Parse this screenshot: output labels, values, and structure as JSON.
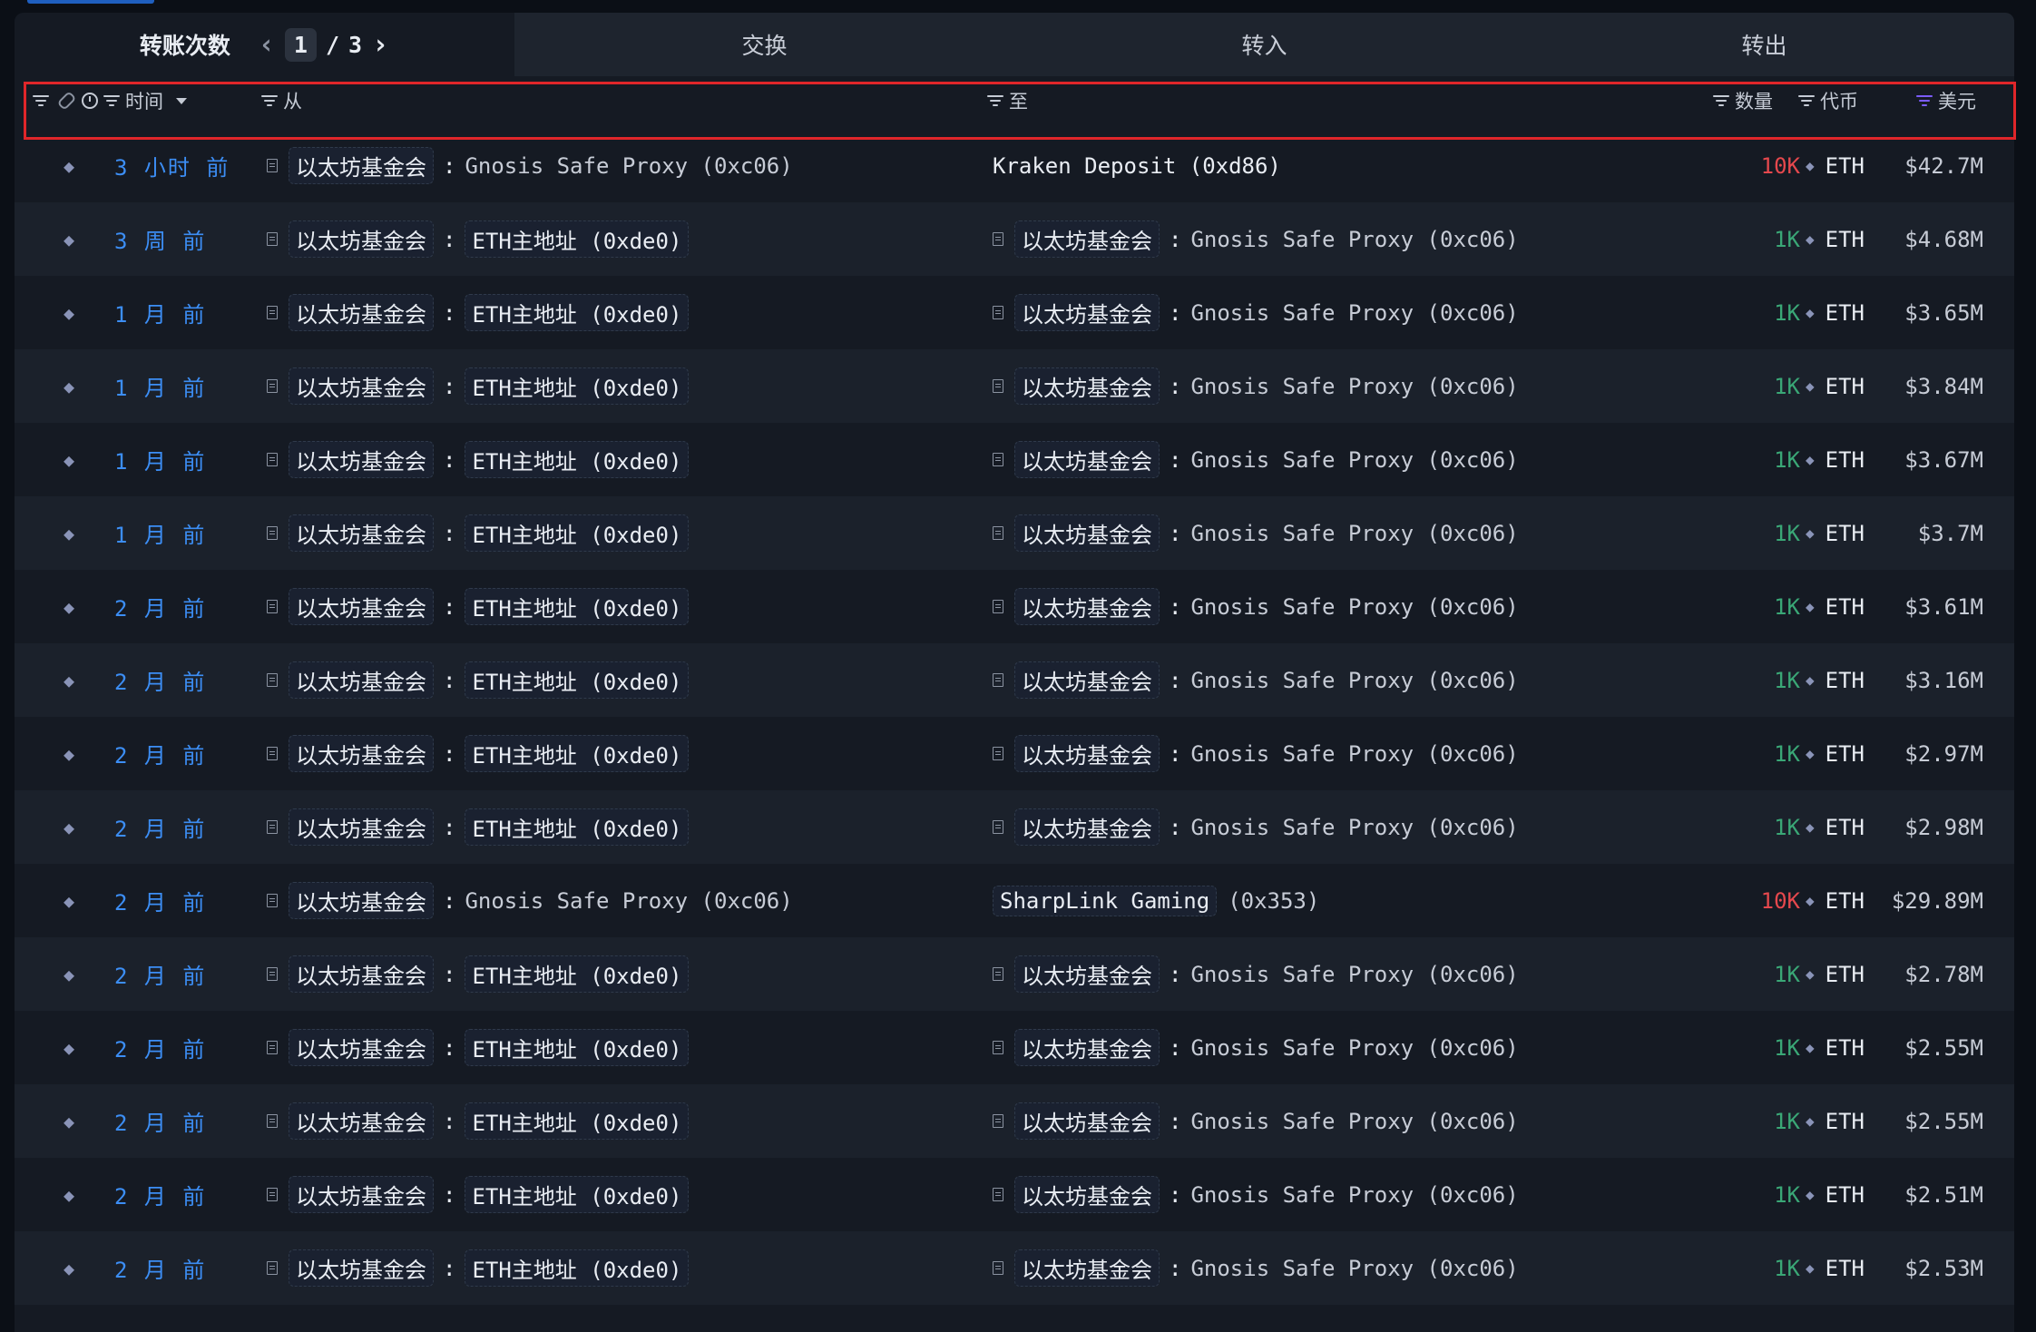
{
  "tabs": {
    "transfers_label": "转账次数",
    "swap_label": "交换",
    "inflow_label": "转入",
    "outflow_label": "转出",
    "page_current": "1",
    "page_sep": "/",
    "page_total": "3"
  },
  "header": {
    "time": "时间",
    "from": "从",
    "to": "至",
    "quantity": "数量",
    "token": "代币",
    "usd": "美元"
  },
  "colors": {
    "accent_blue": "#3c8ef5",
    "green": "#3aa776",
    "red": "#e5484d",
    "highlight": "#e0262a"
  },
  "rows": [
    {
      "time": "3 小时 前",
      "from_entity": "以太坊基金会",
      "from_addr": "Gnosis Safe Proxy (0xc06)",
      "to_entity": "",
      "to_addr": "Kraken Deposit (0xd86)",
      "qty": "10K",
      "qty_color": "red",
      "token": "ETH",
      "usd": "$42.7M"
    },
    {
      "time": "3 周 前",
      "from_entity": "以太坊基金会",
      "from_addr": "ETH主地址 (0xde0)",
      "to_entity": "以太坊基金会",
      "to_addr": "Gnosis Safe Proxy (0xc06)",
      "qty": "1K",
      "qty_color": "green",
      "token": "ETH",
      "usd": "$4.68M"
    },
    {
      "time": "1 月 前",
      "from_entity": "以太坊基金会",
      "from_addr": "ETH主地址 (0xde0)",
      "to_entity": "以太坊基金会",
      "to_addr": "Gnosis Safe Proxy (0xc06)",
      "qty": "1K",
      "qty_color": "green",
      "token": "ETH",
      "usd": "$3.65M"
    },
    {
      "time": "1 月 前",
      "from_entity": "以太坊基金会",
      "from_addr": "ETH主地址 (0xde0)",
      "to_entity": "以太坊基金会",
      "to_addr": "Gnosis Safe Proxy (0xc06)",
      "qty": "1K",
      "qty_color": "green",
      "token": "ETH",
      "usd": "$3.84M"
    },
    {
      "time": "1 月 前",
      "from_entity": "以太坊基金会",
      "from_addr": "ETH主地址 (0xde0)",
      "to_entity": "以太坊基金会",
      "to_addr": "Gnosis Safe Proxy (0xc06)",
      "qty": "1K",
      "qty_color": "green",
      "token": "ETH",
      "usd": "$3.67M"
    },
    {
      "time": "1 月 前",
      "from_entity": "以太坊基金会",
      "from_addr": "ETH主地址 (0xde0)",
      "to_entity": "以太坊基金会",
      "to_addr": "Gnosis Safe Proxy (0xc06)",
      "qty": "1K",
      "qty_color": "green",
      "token": "ETH",
      "usd": "$3.7M"
    },
    {
      "time": "2 月 前",
      "from_entity": "以太坊基金会",
      "from_addr": "ETH主地址 (0xde0)",
      "to_entity": "以太坊基金会",
      "to_addr": "Gnosis Safe Proxy (0xc06)",
      "qty": "1K",
      "qty_color": "green",
      "token": "ETH",
      "usd": "$3.61M"
    },
    {
      "time": "2 月 前",
      "from_entity": "以太坊基金会",
      "from_addr": "ETH主地址 (0xde0)",
      "to_entity": "以太坊基金会",
      "to_addr": "Gnosis Safe Proxy (0xc06)",
      "qty": "1K",
      "qty_color": "green",
      "token": "ETH",
      "usd": "$3.16M"
    },
    {
      "time": "2 月 前",
      "from_entity": "以太坊基金会",
      "from_addr": "ETH主地址 (0xde0)",
      "to_entity": "以太坊基金会",
      "to_addr": "Gnosis Safe Proxy (0xc06)",
      "qty": "1K",
      "qty_color": "green",
      "token": "ETH",
      "usd": "$2.97M"
    },
    {
      "time": "2 月 前",
      "from_entity": "以太坊基金会",
      "from_addr": "ETH主地址 (0xde0)",
      "to_entity": "以太坊基金会",
      "to_addr": "Gnosis Safe Proxy (0xc06)",
      "qty": "1K",
      "qty_color": "green",
      "token": "ETH",
      "usd": "$2.98M"
    },
    {
      "time": "2 月 前",
      "from_entity": "以太坊基金会",
      "from_addr": "Gnosis Safe Proxy (0xc06)",
      "to_entity": "SharpLink Gaming",
      "to_addr": "(0x353)",
      "qty": "10K",
      "qty_color": "red",
      "token": "ETH",
      "usd": "$29.89M",
      "to_no_doc": true
    },
    {
      "time": "2 月 前",
      "from_entity": "以太坊基金会",
      "from_addr": "ETH主地址 (0xde0)",
      "to_entity": "以太坊基金会",
      "to_addr": "Gnosis Safe Proxy (0xc06)",
      "qty": "1K",
      "qty_color": "green",
      "token": "ETH",
      "usd": "$2.78M"
    },
    {
      "time": "2 月 前",
      "from_entity": "以太坊基金会",
      "from_addr": "ETH主地址 (0xde0)",
      "to_entity": "以太坊基金会",
      "to_addr": "Gnosis Safe Proxy (0xc06)",
      "qty": "1K",
      "qty_color": "green",
      "token": "ETH",
      "usd": "$2.55M"
    },
    {
      "time": "2 月 前",
      "from_entity": "以太坊基金会",
      "from_addr": "ETH主地址 (0xde0)",
      "to_entity": "以太坊基金会",
      "to_addr": "Gnosis Safe Proxy (0xc06)",
      "qty": "1K",
      "qty_color": "green",
      "token": "ETH",
      "usd": "$2.55M"
    },
    {
      "time": "2 月 前",
      "from_entity": "以太坊基金会",
      "from_addr": "ETH主地址 (0xde0)",
      "to_entity": "以太坊基金会",
      "to_addr": "Gnosis Safe Proxy (0xc06)",
      "qty": "1K",
      "qty_color": "green",
      "token": "ETH",
      "usd": "$2.51M"
    },
    {
      "time": "2 月 前",
      "from_entity": "以太坊基金会",
      "from_addr": "ETH主地址 (0xde0)",
      "to_entity": "以太坊基金会",
      "to_addr": "Gnosis Safe Proxy (0xc06)",
      "qty": "1K",
      "qty_color": "green",
      "token": "ETH",
      "usd": "$2.53M"
    }
  ]
}
